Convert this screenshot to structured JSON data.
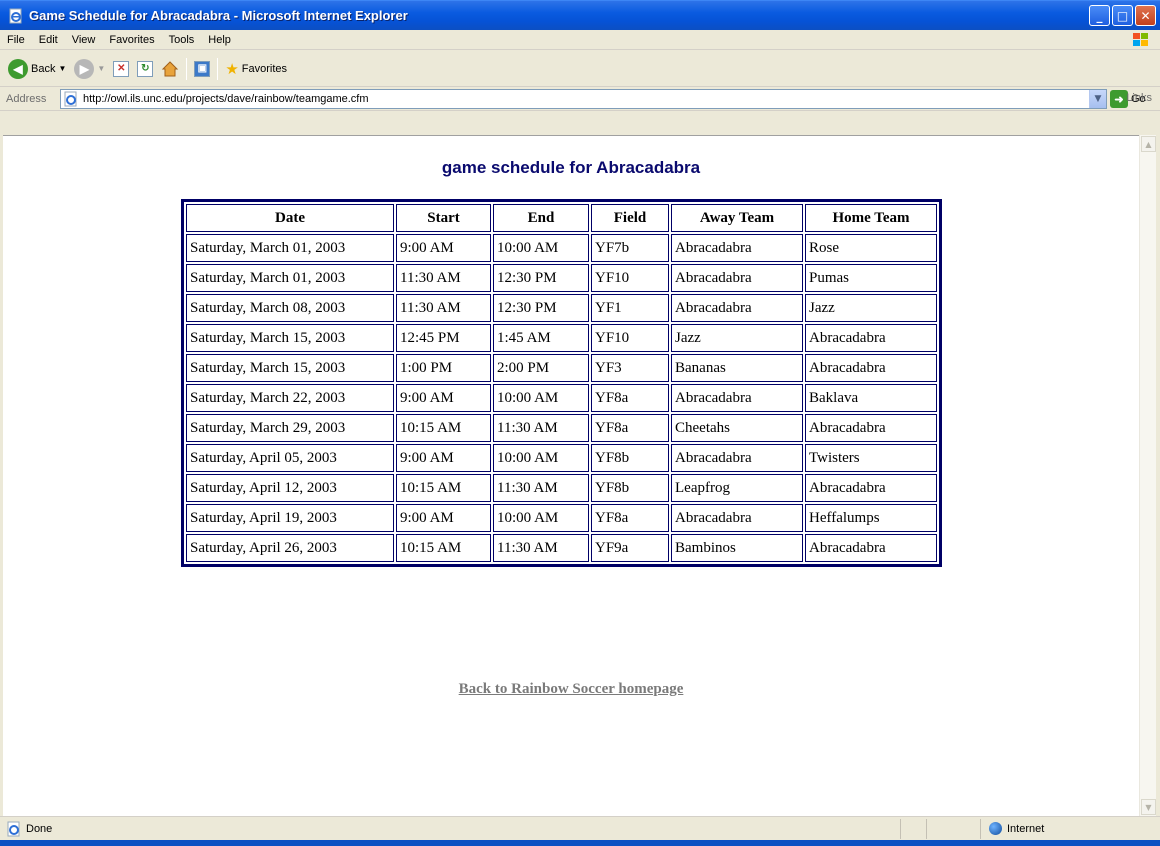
{
  "window": {
    "title": "Game Schedule for Abracadabra - Microsoft Internet Explorer",
    "controls": [
      "_",
      "□",
      "✕"
    ]
  },
  "menu": [
    "File",
    "Edit",
    "View",
    "Favorites",
    "Tools",
    "Help"
  ],
  "toolbar": {
    "back_label": "Back",
    "favorites_label": "Favorites"
  },
  "address": {
    "label": "Address",
    "url": "http://owl.ils.unc.edu/projects/dave/rainbow/teamgame.cfm",
    "go_label": "Go",
    "links_label": "Links"
  },
  "page": {
    "heading": "game schedule for Abracadabra",
    "back_link": "Back to Rainbow Soccer homepage"
  },
  "schedule": {
    "headers": [
      "Date",
      "Start",
      "End",
      "Field",
      "Away Team",
      "Home Team"
    ],
    "rows": [
      [
        "Saturday, March 01, 2003",
        "9:00 AM",
        "10:00 AM",
        "YF7b",
        "Abracadabra",
        "Rose"
      ],
      [
        "Saturday, March 01, 2003",
        "11:30 AM",
        "12:30 PM",
        "YF10",
        "Abracadabra",
        "Pumas"
      ],
      [
        "Saturday, March 08, 2003",
        "11:30 AM",
        "12:30 PM",
        "YF1",
        "Abracadabra",
        "Jazz"
      ],
      [
        "Saturday, March 15, 2003",
        "12:45 PM",
        "1:45 AM",
        "YF10",
        "Jazz",
        "Abracadabra"
      ],
      [
        "Saturday, March 15, 2003",
        "1:00 PM",
        "2:00 PM",
        "YF3",
        "Bananas",
        "Abracadabra"
      ],
      [
        "Saturday, March 22, 2003",
        "9:00 AM",
        "10:00 AM",
        "YF8a",
        "Abracadabra",
        "Baklava"
      ],
      [
        "Saturday, March 29, 2003",
        "10:15 AM",
        "11:30 AM",
        "YF8a",
        "Cheetahs",
        "Abracadabra"
      ],
      [
        "Saturday, April 05, 2003",
        "9:00 AM",
        "10:00 AM",
        "YF8b",
        "Abracadabra",
        "Twisters"
      ],
      [
        "Saturday, April 12, 2003",
        "10:15 AM",
        "11:30 AM",
        "YF8b",
        "Leapfrog",
        "Abracadabra"
      ],
      [
        "Saturday, April 19, 2003",
        "9:00 AM",
        "10:00 AM",
        "YF8a",
        "Abracadabra",
        "Heffalumps"
      ],
      [
        "Saturday, April 26, 2003",
        "10:15 AM",
        "11:30 AM",
        "YF9a",
        "Bambinos",
        "Abracadabra"
      ]
    ]
  },
  "status": {
    "text": "Done",
    "zone": "Internet"
  },
  "icons": {
    "window": "ie-page-icon",
    "back": "back-arrow-icon",
    "forward": "forward-arrow-icon",
    "stop": "stop-icon",
    "refresh": "refresh-icon",
    "home": "home-icon",
    "media": "media-icon",
    "favorites": "star-icon",
    "go": "go-arrow-icon",
    "zone": "globe-icon"
  },
  "colors": {
    "titlebar": "#0A5BE0",
    "heading": "#0A0A6E",
    "table_border": "#000066",
    "link": "#7a7a7a"
  }
}
